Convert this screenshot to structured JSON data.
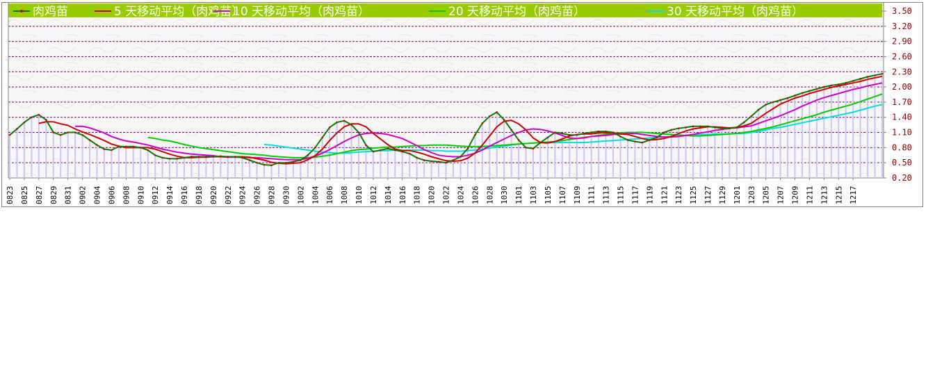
{
  "chart_data": {
    "type": "line",
    "ylim": [
      0.2,
      3.5
    ],
    "yticks": [
      "0.20",
      "0.50",
      "0.80",
      "1.10",
      "1.40",
      "1.70",
      "2.00",
      "2.30",
      "2.60",
      "2.90",
      "3.20",
      "3.50"
    ],
    "xtick_labels": [
      "0823",
      "0825",
      "0827",
      "0829",
      "0831",
      "0902",
      "0904",
      "0906",
      "0908",
      "0910",
      "0912",
      "0914",
      "0916",
      "0918",
      "0920",
      "0922",
      "0924",
      "0926",
      "0928",
      "0930",
      "1002",
      "1004",
      "1006",
      "1008",
      "1010",
      "1012",
      "1014",
      "1016",
      "1018",
      "1020",
      "1022",
      "1024",
      "1026",
      "1028",
      "1030",
      "1101",
      "1103",
      "1105",
      "1107",
      "1109",
      "1111",
      "1113",
      "1115",
      "1117",
      "1119",
      "1121",
      "1123",
      "1125",
      "1127",
      "1129",
      "1201",
      "1203",
      "1205",
      "1207",
      "1209",
      "1211",
      "1213",
      "1215",
      "1217"
    ],
    "legend_position": "top",
    "grid": true,
    "series": [
      {
        "name": "肉鸡苗",
        "color": "#008000",
        "marker_color": "#cc0000",
        "values": [
          1.05,
          1.17,
          1.3,
          1.4,
          1.45,
          1.35,
          1.1,
          1.05,
          1.1,
          1.1,
          1.05,
          0.95,
          0.85,
          0.77,
          0.75,
          0.82,
          0.82,
          0.82,
          0.8,
          0.75,
          0.65,
          0.6,
          0.58,
          0.58,
          0.6,
          0.62,
          0.62,
          0.62,
          0.62,
          0.63,
          0.62,
          0.62,
          0.6,
          0.55,
          0.5,
          0.46,
          0.45,
          0.5,
          0.5,
          0.52,
          0.55,
          0.65,
          0.8,
          1.0,
          1.2,
          1.3,
          1.33,
          1.25,
          1.1,
          0.85,
          0.72,
          0.75,
          0.78,
          0.75,
          0.72,
          0.68,
          0.6,
          0.55,
          0.53,
          0.52,
          0.5,
          0.55,
          0.62,
          0.78,
          1.05,
          1.28,
          1.42,
          1.5,
          1.35,
          1.15,
          0.95,
          0.8,
          0.78,
          0.9,
          1.0,
          1.1,
          1.08,
          1.05,
          1.05,
          1.08,
          1.1,
          1.12,
          1.12,
          1.1,
          1.02,
          0.95,
          0.92,
          0.9,
          0.95,
          1.0,
          1.1,
          1.15,
          1.18,
          1.2,
          1.22,
          1.22,
          1.22,
          1.2,
          1.18,
          1.18,
          1.2,
          1.3,
          1.42,
          1.55,
          1.65,
          1.7,
          1.74,
          1.78,
          1.83,
          1.88,
          1.92,
          1.96,
          2.0,
          2.03,
          2.05,
          2.08,
          2.12,
          2.16,
          2.2,
          2.23,
          2.26
        ]
      },
      {
        "name": "5 天移动平均（肉鸡苗）",
        "color": "#cc0000",
        "values": [
          null,
          null,
          null,
          null,
          1.28,
          1.31,
          1.31,
          1.27,
          1.24,
          1.17,
          1.11,
          1.06,
          1.0,
          0.94,
          0.87,
          0.83,
          0.8,
          0.8,
          0.8,
          0.8,
          0.77,
          0.72,
          0.67,
          0.63,
          0.6,
          0.6,
          0.61,
          0.61,
          0.62,
          0.62,
          0.62,
          0.62,
          0.62,
          0.61,
          0.58,
          0.55,
          0.51,
          0.49,
          0.48,
          0.49,
          0.5,
          0.56,
          0.64,
          0.77,
          0.94,
          1.09,
          1.21,
          1.27,
          1.27,
          1.21,
          1.08,
          0.97,
          0.86,
          0.77,
          0.74,
          0.74,
          0.71,
          0.67,
          0.62,
          0.58,
          0.54,
          0.53,
          0.54,
          0.59,
          0.69,
          0.85,
          1.03,
          1.21,
          1.32,
          1.34,
          1.27,
          1.15,
          0.99,
          0.9,
          0.89,
          0.92,
          0.97,
          1.03,
          1.06,
          1.07,
          1.07,
          1.09,
          1.09,
          1.09,
          1.07,
          1.06,
          1.02,
          0.98,
          0.95,
          0.96,
          0.98,
          1.02,
          1.08,
          1.13,
          1.17,
          1.19,
          1.21,
          1.21,
          1.2,
          1.19,
          1.2,
          1.23,
          1.28,
          1.38,
          1.48,
          1.57,
          1.66,
          1.72,
          1.78,
          1.82,
          1.87,
          1.91,
          1.95,
          1.99,
          2.02,
          2.05,
          2.08,
          2.11,
          2.15,
          2.18,
          2.21
        ]
      },
      {
        "name": "10 天移动平均（肉鸡苗）",
        "color": "#cc00cc",
        "values": [
          null,
          null,
          null,
          null,
          null,
          null,
          null,
          null,
          null,
          1.22,
          1.22,
          1.19,
          1.14,
          1.09,
          1.02,
          0.97,
          0.93,
          0.91,
          0.88,
          0.85,
          0.81,
          0.77,
          0.74,
          0.71,
          0.69,
          0.67,
          0.66,
          0.65,
          0.64,
          0.62,
          0.61,
          0.61,
          0.61,
          0.6,
          0.6,
          0.59,
          0.58,
          0.57,
          0.56,
          0.56,
          0.56,
          0.59,
          0.63,
          0.69,
          0.76,
          0.84,
          0.92,
          0.99,
          1.05,
          1.08,
          1.09,
          1.08,
          1.06,
          1.02,
          0.98,
          0.91,
          0.84,
          0.76,
          0.7,
          0.65,
          0.63,
          0.62,
          0.62,
          0.65,
          0.69,
          0.75,
          0.83,
          0.9,
          0.97,
          1.04,
          1.1,
          1.15,
          1.17,
          1.16,
          1.13,
          1.09,
          1.04,
          0.99,
          0.98,
          0.99,
          1.02,
          1.03,
          1.04,
          1.06,
          1.07,
          1.08,
          1.08,
          1.06,
          1.04,
          1.02,
          1.01,
          1.01,
          1.02,
          1.04,
          1.06,
          1.09,
          1.11,
          1.14,
          1.16,
          1.18,
          1.19,
          1.21,
          1.23,
          1.28,
          1.33,
          1.38,
          1.43,
          1.49,
          1.55,
          1.62,
          1.68,
          1.74,
          1.79,
          1.83,
          1.87,
          1.91,
          1.95,
          1.98,
          2.02,
          2.05,
          2.08
        ]
      },
      {
        "name": "20 天移动平均（肉鸡苗）",
        "color": "#00cc00",
        "values": [
          null,
          null,
          null,
          null,
          null,
          null,
          null,
          null,
          null,
          null,
          null,
          null,
          null,
          null,
          null,
          null,
          null,
          null,
          null,
          1.0,
          0.98,
          0.95,
          0.93,
          0.9,
          0.86,
          0.83,
          0.8,
          0.78,
          0.76,
          0.74,
          0.72,
          0.7,
          0.68,
          0.67,
          0.66,
          0.65,
          0.63,
          0.62,
          0.61,
          0.6,
          0.6,
          0.6,
          0.61,
          0.63,
          0.65,
          0.68,
          0.71,
          0.74,
          0.76,
          0.77,
          0.79,
          0.8,
          0.81,
          0.81,
          0.82,
          0.83,
          0.84,
          0.84,
          0.85,
          0.85,
          0.85,
          0.84,
          0.83,
          0.82,
          0.82,
          0.82,
          0.83,
          0.84,
          0.85,
          0.86,
          0.87,
          0.88,
          0.89,
          0.9,
          0.91,
          0.92,
          0.94,
          0.96,
          0.98,
          1.0,
          1.02,
          1.04,
          1.06,
          1.08,
          1.09,
          1.1,
          1.1,
          1.1,
          1.09,
          1.08,
          1.07,
          1.06,
          1.05,
          1.04,
          1.03,
          1.03,
          1.04,
          1.05,
          1.06,
          1.07,
          1.08,
          1.1,
          1.12,
          1.15,
          1.18,
          1.21,
          1.25,
          1.29,
          1.33,
          1.37,
          1.41,
          1.45,
          1.5,
          1.54,
          1.58,
          1.62,
          1.66,
          1.71,
          1.76,
          1.81,
          1.86
        ]
      },
      {
        "name": "30 天移动平均（肉鸡苗）",
        "color": "#00dddd",
        "values": [
          null,
          null,
          null,
          null,
          null,
          null,
          null,
          null,
          null,
          null,
          null,
          null,
          null,
          null,
          null,
          null,
          null,
          null,
          null,
          null,
          null,
          null,
          null,
          null,
          null,
          null,
          null,
          null,
          null,
          null,
          null,
          null,
          null,
          null,
          null,
          0.86,
          0.85,
          0.83,
          0.81,
          0.79,
          0.77,
          0.75,
          0.73,
          0.71,
          0.7,
          0.69,
          0.69,
          0.7,
          0.71,
          0.72,
          0.73,
          0.74,
          0.74,
          0.75,
          0.75,
          0.75,
          0.75,
          0.75,
          0.74,
          0.74,
          0.73,
          0.73,
          0.73,
          0.74,
          0.75,
          0.77,
          0.79,
          0.81,
          0.83,
          0.85,
          0.87,
          0.88,
          0.89,
          0.9,
          0.9,
          0.9,
          0.9,
          0.9,
          0.9,
          0.9,
          0.91,
          0.92,
          0.93,
          0.94,
          0.95,
          0.96,
          0.97,
          0.98,
          0.99,
          1.0,
          1.01,
          1.02,
          1.03,
          1.04,
          1.05,
          1.06,
          1.06,
          1.07,
          1.07,
          1.07,
          1.08,
          1.08,
          1.1,
          1.12,
          1.15,
          1.18,
          1.2,
          1.23,
          1.26,
          1.29,
          1.32,
          1.35,
          1.38,
          1.41,
          1.44,
          1.47,
          1.5,
          1.54,
          1.58,
          1.62,
          1.65
        ]
      }
    ]
  }
}
